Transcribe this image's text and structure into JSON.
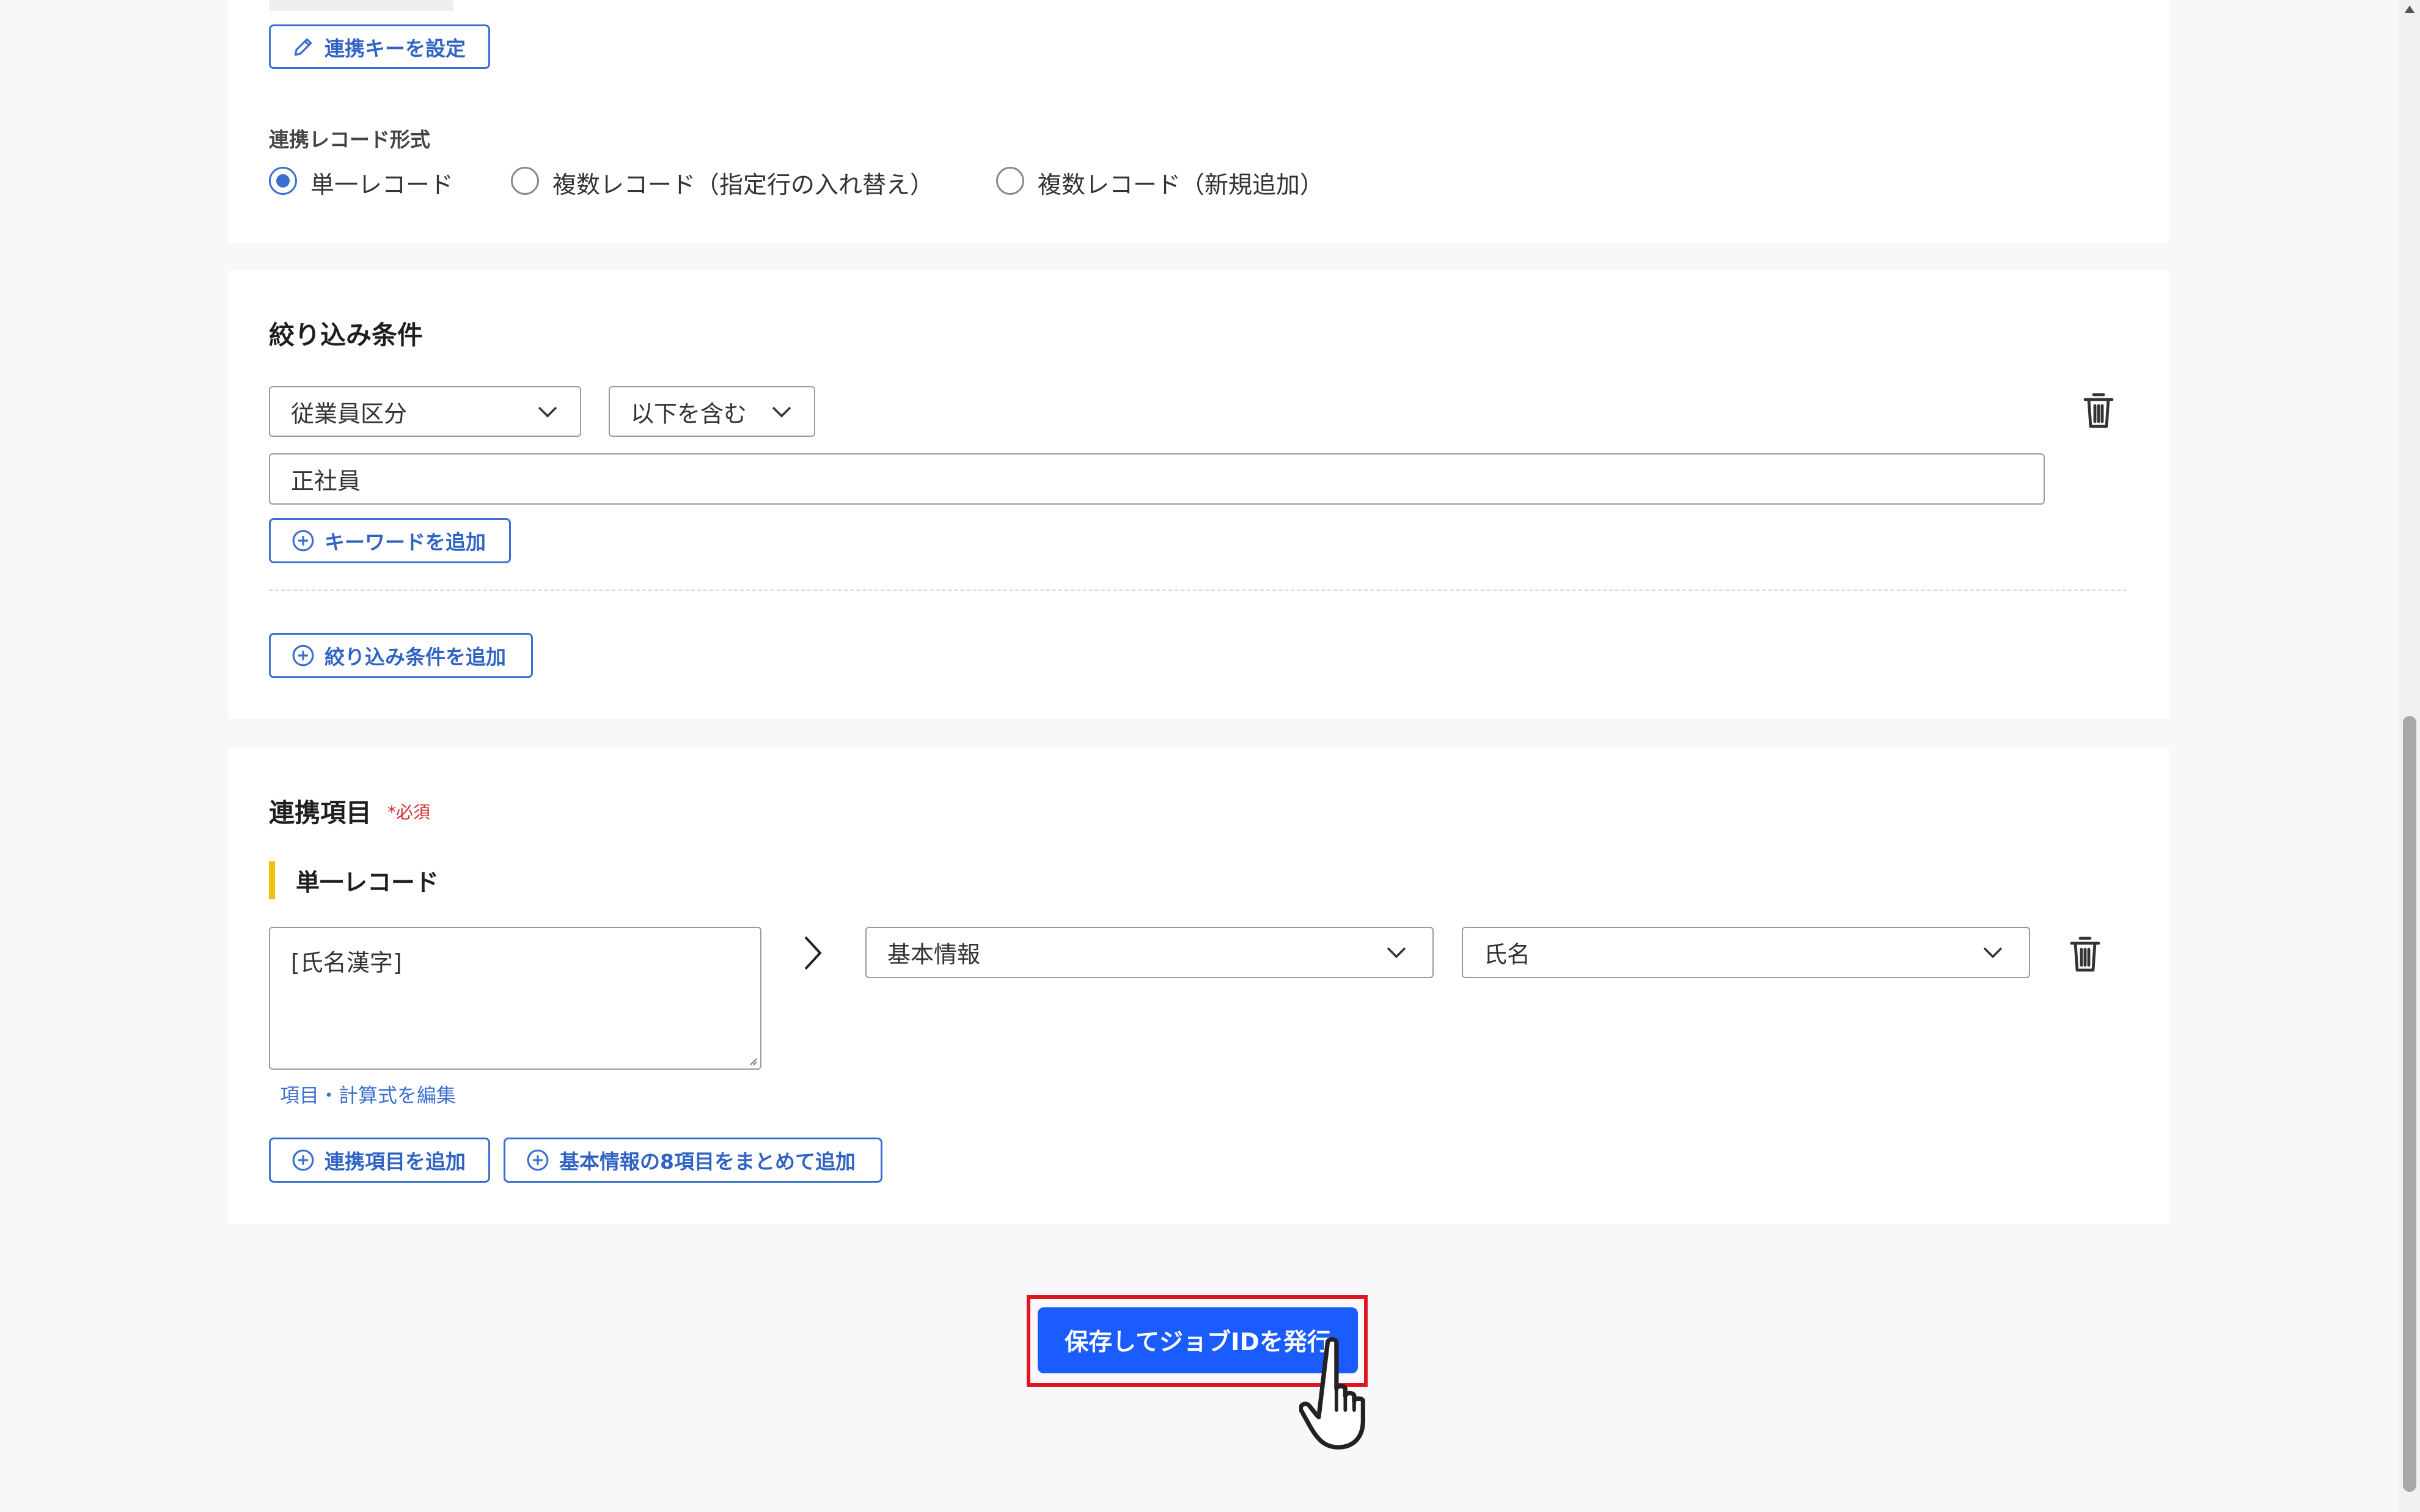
{
  "top_section": {
    "set_key_button": "連携キーを設定",
    "record_format_label": "連携レコード形式",
    "record_format_options": [
      {
        "label": "単一レコード",
        "selected": true
      },
      {
        "label": "複数レコード（指定行の入れ替え）",
        "selected": false
      },
      {
        "label": "複数レコード（新規追加）",
        "selected": false
      }
    ]
  },
  "filter_section": {
    "title": "絞り込み条件",
    "field_select": "従業員区分",
    "operator_select": "以下を含む",
    "keyword_value": "正社員",
    "add_keyword_button": "キーワードを追加",
    "add_condition_button": "絞り込み条件を追加"
  },
  "mapping_section": {
    "title": "連携項目",
    "required_mark": "*必須",
    "subsection_title": "単一レコード",
    "source_expression": "[氏名漢字]",
    "edit_link": "項目・計算式を編集",
    "category_select": "基本情報",
    "field_select": "氏名",
    "add_mapping_button": "連携項目を追加",
    "add_bulk_button": "基本情報の8項目をまとめて追加"
  },
  "footer": {
    "save_button": "保存してジョブIDを発行"
  },
  "colors": {
    "accent": "#3a6fd0",
    "primary_button": "#1a5cff",
    "highlight_border": "#e0141e",
    "required": "#d0312d",
    "subsection_bar": "#f2c200"
  }
}
